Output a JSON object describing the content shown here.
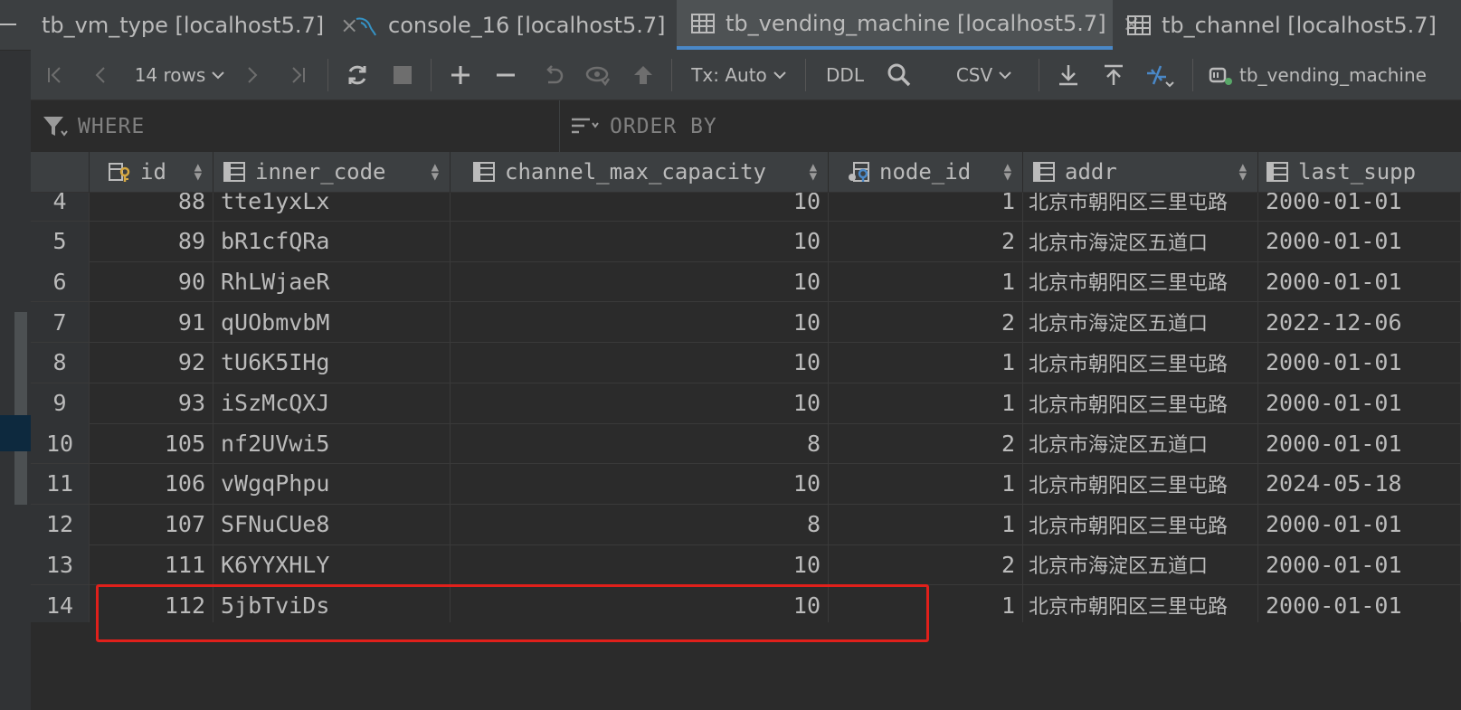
{
  "tabs": [
    {
      "label": "tb_vm_type [localhost5.7]",
      "icon": "table-icon",
      "active": false,
      "closable": true
    },
    {
      "label": "console_16 [localhost5.7]",
      "icon": "mysql-console-icon",
      "active": false,
      "closable": false
    },
    {
      "label": "tb_vending_machine [localhost5.7]",
      "icon": "table-icon",
      "active": true,
      "closable": true
    },
    {
      "label": "tb_channel [localhost5.7]",
      "icon": "table-icon",
      "active": false,
      "closable": false
    }
  ],
  "toolbar": {
    "rows_label": "14 rows",
    "tx_label": "Tx: Auto",
    "ddl_label": "DDL",
    "csv_label": "CSV",
    "datasource_label": "tb_vending_machine",
    "close_glyph": "×"
  },
  "filter": {
    "where_label": "WHERE",
    "order_by_label": "ORDER BY"
  },
  "grid": {
    "columns": [
      {
        "name": "id",
        "icon": "primary-key-column-icon"
      },
      {
        "name": "inner_code",
        "icon": "column-icon"
      },
      {
        "name": "channel_max_capacity",
        "icon": "column-icon"
      },
      {
        "name": "node_id",
        "icon": "foreign-key-column-icon"
      },
      {
        "name": "addr",
        "icon": "column-icon"
      },
      {
        "name": "last_supp",
        "icon": "column-icon"
      }
    ],
    "rows": [
      {
        "rn": "4",
        "id": "88",
        "inner_code": "tte1yxLx",
        "cap": "10",
        "node_id": "1",
        "addr": "北京市朝阳区三里屯路",
        "last": "2000-01-01"
      },
      {
        "rn": "5",
        "id": "89",
        "inner_code": "bR1cfQRa",
        "cap": "10",
        "node_id": "2",
        "addr": "北京市海淀区五道口",
        "last": "2000-01-01"
      },
      {
        "rn": "6",
        "id": "90",
        "inner_code": "RhLWjaeR",
        "cap": "10",
        "node_id": "1",
        "addr": "北京市朝阳区三里屯路",
        "last": "2000-01-01"
      },
      {
        "rn": "7",
        "id": "91",
        "inner_code": "qUObmvbM",
        "cap": "10",
        "node_id": "2",
        "addr": "北京市海淀区五道口",
        "last": "2022-12-06"
      },
      {
        "rn": "8",
        "id": "92",
        "inner_code": "tU6K5IHg",
        "cap": "10",
        "node_id": "1",
        "addr": "北京市朝阳区三里屯路",
        "last": "2000-01-01"
      },
      {
        "rn": "9",
        "id": "93",
        "inner_code": "iSzMcQXJ",
        "cap": "10",
        "node_id": "1",
        "addr": "北京市朝阳区三里屯路",
        "last": "2000-01-01"
      },
      {
        "rn": "10",
        "id": "105",
        "inner_code": "nf2UVwi5",
        "cap": "8",
        "node_id": "2",
        "addr": "北京市海淀区五道口",
        "last": "2000-01-01"
      },
      {
        "rn": "11",
        "id": "106",
        "inner_code": "vWgqPhpu",
        "cap": "10",
        "node_id": "1",
        "addr": "北京市朝阳区三里屯路",
        "last": "2024-05-18"
      },
      {
        "rn": "12",
        "id": "107",
        "inner_code": "SFNuCUe8",
        "cap": "8",
        "node_id": "1",
        "addr": "北京市朝阳区三里屯路",
        "last": "2000-01-01"
      },
      {
        "rn": "13",
        "id": "111",
        "inner_code": "K6YYXHLY",
        "cap": "10",
        "node_id": "2",
        "addr": "北京市海淀区五道口",
        "last": "2000-01-01"
      },
      {
        "rn": "14",
        "id": "112",
        "inner_code": "5jbTviDs",
        "cap": "10",
        "node_id": "1",
        "addr": "北京市朝阳区三里屯路",
        "last": "2000-01-01"
      }
    ]
  },
  "colors": {
    "background": "#2b2b2b",
    "active_tab_underline": "#4a88c7",
    "highlight_box": "#e0201b",
    "toolbar_accent": "#4a88c7"
  }
}
